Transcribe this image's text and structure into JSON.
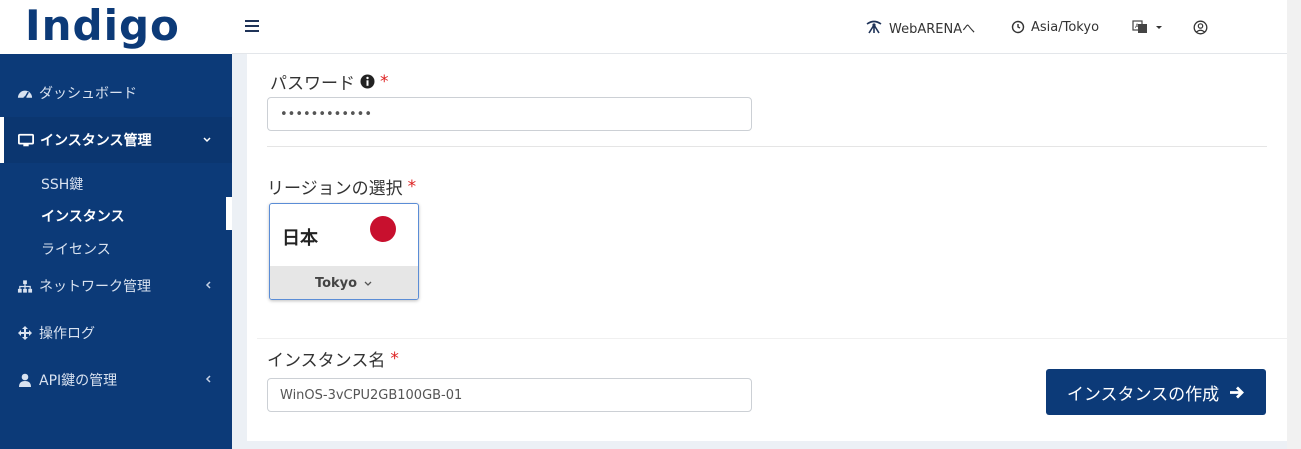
{
  "header": {
    "logo_text": "Indigo",
    "webarena_link": "WebARENAへ",
    "timezone": "Asia/Tokyo"
  },
  "sidebar": {
    "items": [
      {
        "label": "ダッシュボード",
        "icon": "dashboard-icon"
      },
      {
        "label": "インスタンス管理",
        "icon": "monitor-icon",
        "active": true
      },
      {
        "label": "ネットワーク管理",
        "icon": "network-icon"
      },
      {
        "label": "操作ログ",
        "icon": "arrows-icon"
      },
      {
        "label": "API鍵の管理",
        "icon": "user-icon"
      }
    ],
    "sub_items": [
      {
        "label": "SSH鍵"
      },
      {
        "label": "インスタンス",
        "active": true
      },
      {
        "label": "ライセンス"
      }
    ]
  },
  "form": {
    "password_label": "パスワード",
    "password_value": "••••••••••••",
    "region_label": "リージョンの選択",
    "region_name": "日本",
    "region_city": "Tokyo",
    "instance_name_label": "インスタンス名",
    "instance_name_value": "WinOS-3vCPU2GB100GB-01",
    "required_mark": "*",
    "create_button": "インスタンスの作成"
  },
  "colors": {
    "brand": "#0c3a78",
    "required": "#dd2222",
    "flag": "#c8102e"
  }
}
